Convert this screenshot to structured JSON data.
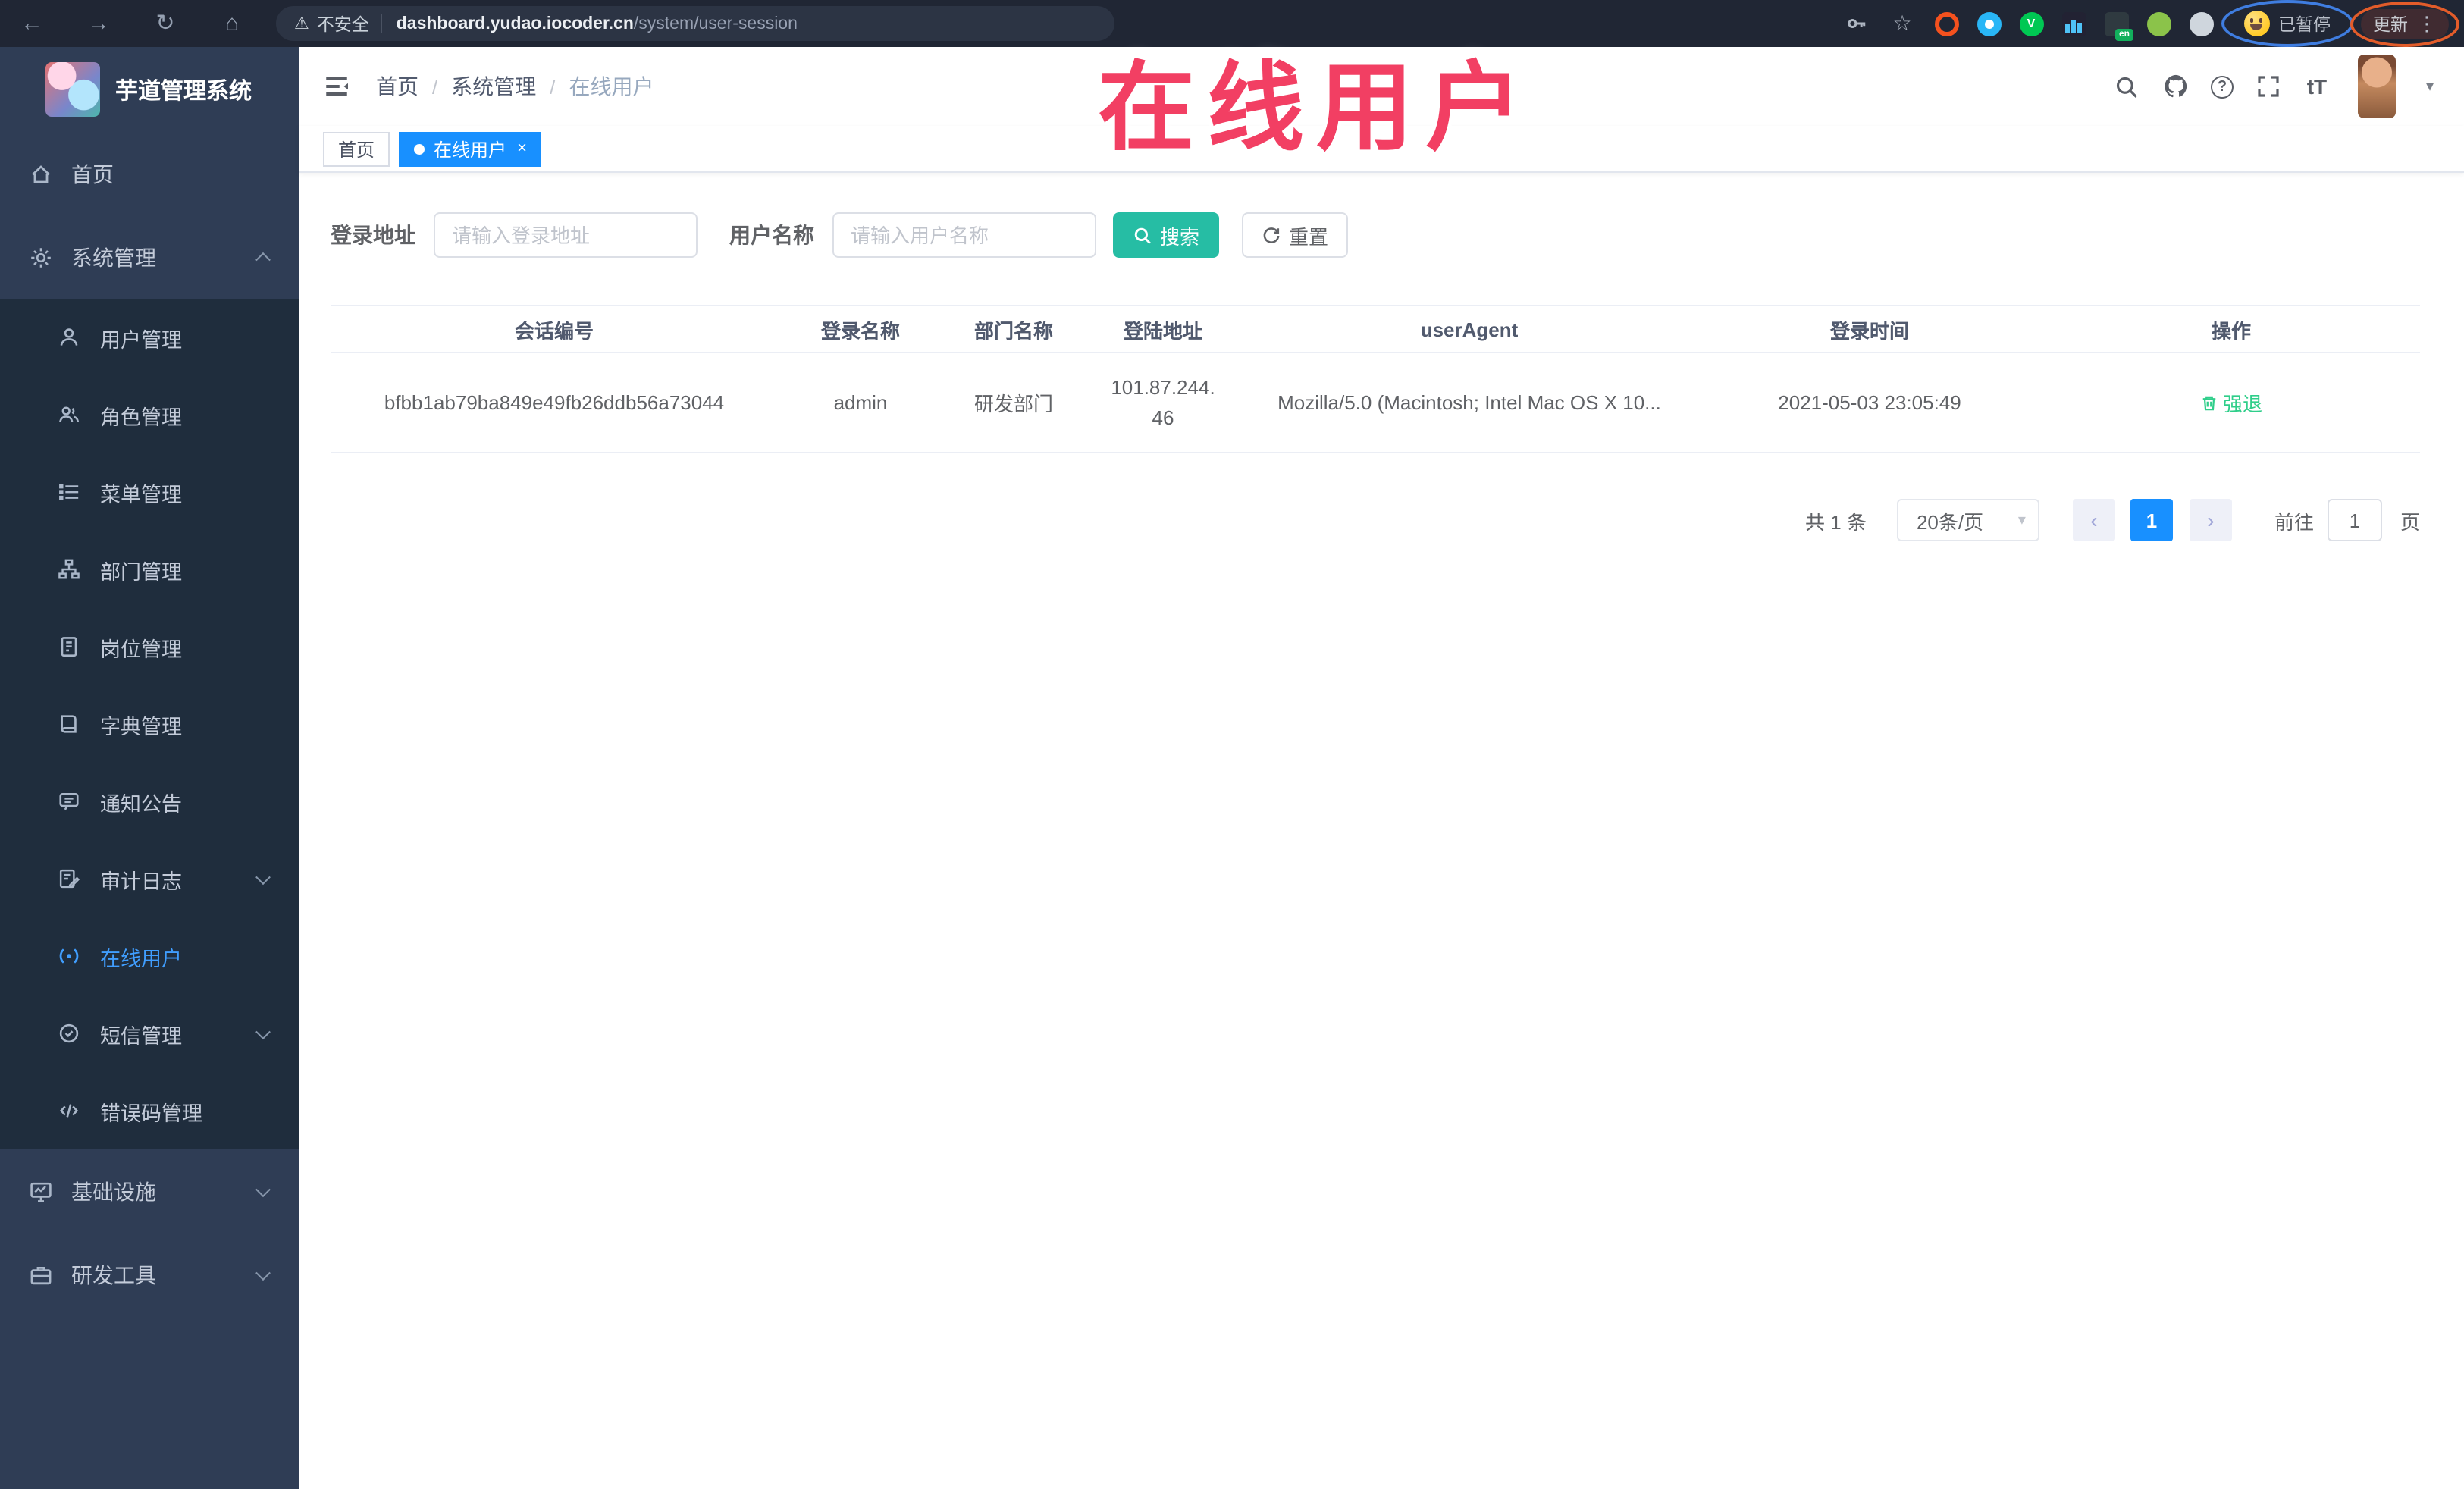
{
  "browser": {
    "security_label": "不安全",
    "url_domain": "dashboard.yudao.iocoder.cn",
    "url_path": "/system/user-session",
    "paused_label": "已暂停",
    "update_label": "更新"
  },
  "watermark": "在线用户",
  "sidebar": {
    "title": "芋道管理系统",
    "items": [
      {
        "label": "首页"
      },
      {
        "label": "系统管理"
      },
      {
        "label": "用户管理"
      },
      {
        "label": "角色管理"
      },
      {
        "label": "菜单管理"
      },
      {
        "label": "部门管理"
      },
      {
        "label": "岗位管理"
      },
      {
        "label": "字典管理"
      },
      {
        "label": "通知公告"
      },
      {
        "label": "审计日志"
      },
      {
        "label": "在线用户"
      },
      {
        "label": "短信管理"
      },
      {
        "label": "错误码管理"
      },
      {
        "label": "基础设施"
      },
      {
        "label": "研发工具"
      }
    ]
  },
  "breadcrumb": [
    "首页",
    "系统管理",
    "在线用户"
  ],
  "tabs": [
    {
      "label": "首页"
    },
    {
      "label": "在线用户"
    }
  ],
  "filters": {
    "address_label": "登录地址",
    "address_placeholder": "请输入登录地址",
    "username_label": "用户名称",
    "username_placeholder": "请输入用户名称",
    "search_label": "搜索",
    "reset_label": "重置"
  },
  "table": {
    "columns": [
      "会话编号",
      "登录名称",
      "部门名称",
      "登陆地址",
      "userAgent",
      "登录时间",
      "操作"
    ],
    "rows": [
      {
        "session_id": "bfbb1ab79ba849e49fb26ddb56a73044",
        "username": "admin",
        "dept": "研发部门",
        "ip_lines": [
          "101.87.244.",
          "46"
        ],
        "user_agent": "Mozilla/5.0 (Macintosh; Intel Mac OS X 10...",
        "login_time": "2021-05-03 23:05:49",
        "action": "强退"
      }
    ]
  },
  "pagination": {
    "total_label": "共 1 条",
    "page_size": "20条/页",
    "current_page": "1",
    "goto_label": "前往",
    "goto_value": "1",
    "page_unit": "页"
  },
  "colors": {
    "accent": "#1890ff",
    "active": "#409eff",
    "sidebarBg": "#2f3d55",
    "submenuBg": "#1f2d3d",
    "browserBg": "#202634",
    "teal": "#26bda4",
    "green": "#2fce8a",
    "watermark": "#f23f63"
  }
}
